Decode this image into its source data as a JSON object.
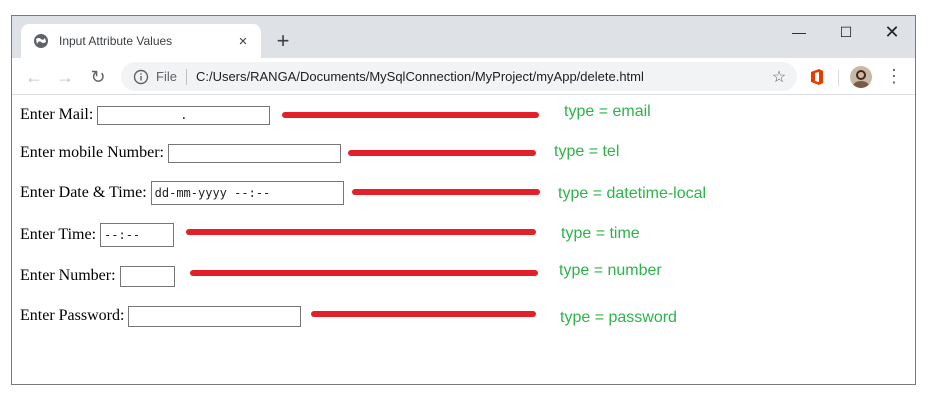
{
  "browser": {
    "tab_title": "Input Attribute Values",
    "tab_close": "×",
    "new_tab": "+",
    "window_controls": {
      "minimize": "—",
      "maximize": "☐",
      "close": "✕"
    },
    "nav": {
      "back": "←",
      "forward": "→",
      "reload": "↻"
    },
    "address_scheme_label": "File",
    "url": "C:/Users/RANGA/Documents/MySqlConnection/MyProject/myApp/delete.html",
    "star": "☆",
    "menu": "⋮"
  },
  "form": {
    "rows": [
      {
        "label": "Enter Mail:",
        "value": ".",
        "note": "type = email"
      },
      {
        "label": "Enter mobile Number:",
        "value": "",
        "note": "type = tel"
      },
      {
        "label": "Enter Date & Time:",
        "value": "dd-mm-yyyy --:--",
        "note": "type = datetime-local"
      },
      {
        "label": "Enter Time:",
        "value": "--:--",
        "note": "type = time"
      },
      {
        "label": "Enter Number:",
        "value": "",
        "note": "type = number"
      },
      {
        "label": "Enter Password:",
        "value": "",
        "note": "type = password"
      }
    ]
  },
  "colors": {
    "annotation_arrow": "#e3202a",
    "annotation_text": "#2eb34b"
  }
}
